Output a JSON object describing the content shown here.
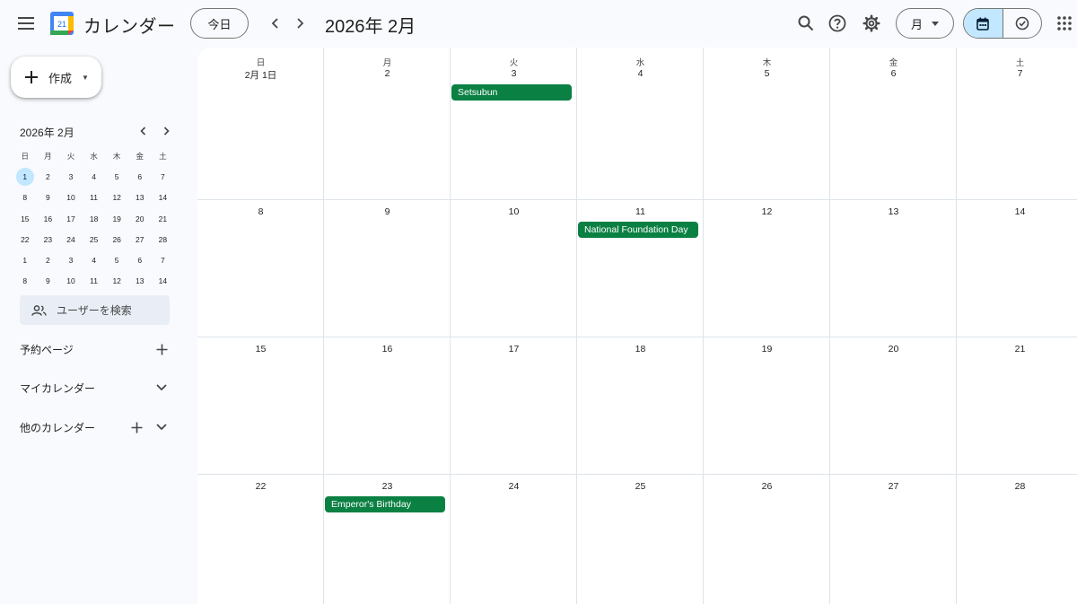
{
  "header": {
    "app_title": "カレンダー",
    "logo_day": "21",
    "today_label": "今日",
    "period_title": "2026年 2月",
    "view_label": "月",
    "icons": [
      "menu-icon",
      "search-icon",
      "help-icon",
      "settings-icon",
      "calendar-icon",
      "task-check-icon",
      "apps-grid-icon"
    ]
  },
  "sidebar": {
    "create_label": "作成",
    "mini_calendar": {
      "title": "2026年 2月",
      "weekdays": [
        "日",
        "月",
        "火",
        "水",
        "木",
        "金",
        "土"
      ],
      "weeks": [
        [
          "1",
          "2",
          "3",
          "4",
          "5",
          "6",
          "7"
        ],
        [
          "8",
          "9",
          "10",
          "11",
          "12",
          "13",
          "14"
        ],
        [
          "15",
          "16",
          "17",
          "18",
          "19",
          "20",
          "21"
        ],
        [
          "22",
          "23",
          "24",
          "25",
          "26",
          "27",
          "28"
        ],
        [
          "1",
          "2",
          "3",
          "4",
          "5",
          "6",
          "7"
        ],
        [
          "8",
          "9",
          "10",
          "11",
          "12",
          "13",
          "14"
        ]
      ],
      "today": "1"
    },
    "people_search_placeholder": "ユーザーを検索",
    "sections": {
      "booking_pages": "予約ページ",
      "my_calendars": "マイカレンダー",
      "other_calendars": "他のカレンダー"
    }
  },
  "month": {
    "weekdays": [
      "日",
      "月",
      "火",
      "水",
      "木",
      "金",
      "土"
    ],
    "weeks": [
      [
        "2月 1日",
        "2",
        "3",
        "4",
        "5",
        "6",
        "7"
      ],
      [
        "8",
        "9",
        "10",
        "11",
        "12",
        "13",
        "14"
      ],
      [
        "15",
        "16",
        "17",
        "18",
        "19",
        "20",
        "21"
      ],
      [
        "22",
        "23",
        "24",
        "25",
        "26",
        "27",
        "28"
      ]
    ],
    "events": [
      {
        "title": "Setsubun",
        "week": 0,
        "day": 2,
        "color": "#0b8043"
      },
      {
        "title": "National Foundation Day",
        "week": 1,
        "day": 3,
        "color": "#0b8043"
      },
      {
        "title": "Emperor's Birthday",
        "week": 3,
        "day": 1,
        "color": "#0b8043"
      }
    ]
  },
  "colors": {
    "accent": "#0b8043",
    "today_highlight": "#c2e7ff",
    "background": "#f8fafd"
  }
}
